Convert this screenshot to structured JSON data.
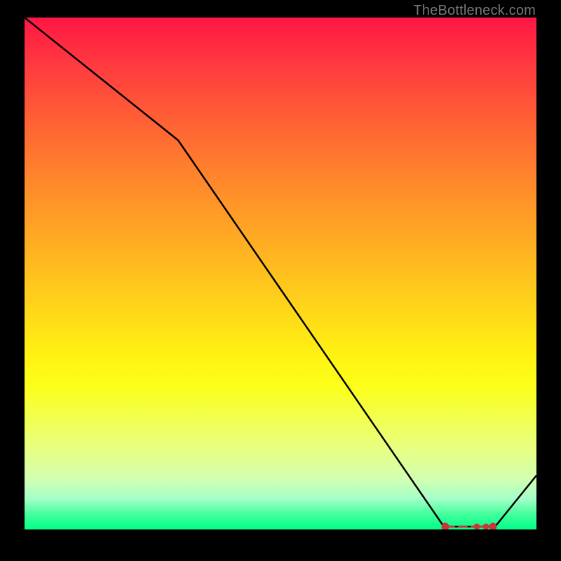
{
  "watermark": "TheBottleneck.com",
  "chart_data": {
    "type": "line",
    "title": "",
    "xlabel": "",
    "ylabel": "",
    "xlim": [
      0,
      100
    ],
    "ylim": [
      0,
      100
    ],
    "x": [
      0,
      30,
      82,
      92,
      100
    ],
    "values": [
      100,
      76,
      0,
      0,
      10
    ],
    "markers": {
      "x_range": [
        82,
        92
      ],
      "y": 0,
      "style": "red-dashed-band"
    },
    "background": {
      "type": "vertical-gradient",
      "stops": [
        {
          "pos": 0,
          "color": "#ff1646"
        },
        {
          "pos": 50,
          "color": "#ffc01e"
        },
        {
          "pos": 75,
          "color": "#fcff1a"
        },
        {
          "pos": 100,
          "color": "#00ff88"
        }
      ]
    }
  },
  "colors": {
    "frame": "#000000",
    "line": "#000000",
    "marker": "#d84040",
    "watermark": "#777777"
  }
}
